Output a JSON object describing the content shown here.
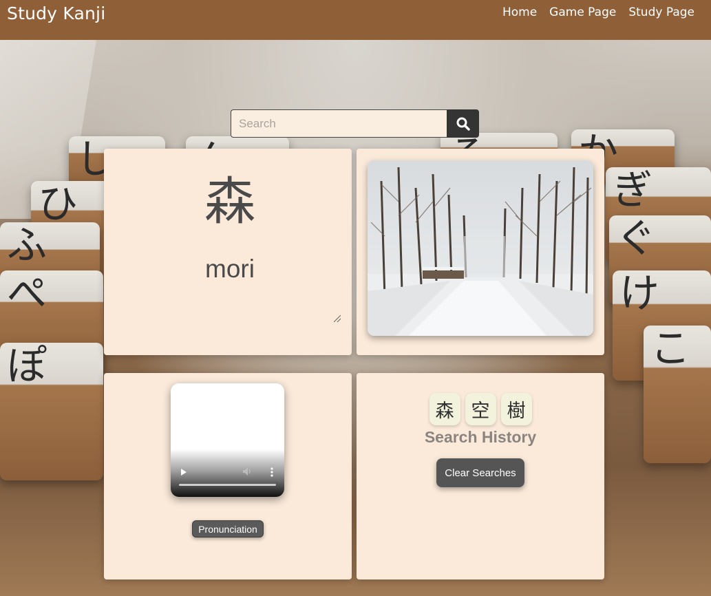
{
  "navbar": {
    "brand": "Study Kanji",
    "links": [
      "Home",
      "Game Page",
      "Study Page"
    ]
  },
  "search": {
    "placeholder": "Search",
    "value": "",
    "button_icon": "search-icon"
  },
  "kanji_card": {
    "character": "森",
    "reading": "mori"
  },
  "image_card": {
    "subject": "snowy forest path"
  },
  "audio_card": {
    "button_label": "Pronunciation"
  },
  "history_card": {
    "chips": [
      "森",
      "空",
      "樹"
    ],
    "title": "Search History",
    "clear_label": "Clear Searches"
  },
  "colors": {
    "navbar": "#8f5f38",
    "card": "#fbeada",
    "chip": "#f3f2dd",
    "dark_button": "#555555",
    "search_button": "#343434"
  }
}
